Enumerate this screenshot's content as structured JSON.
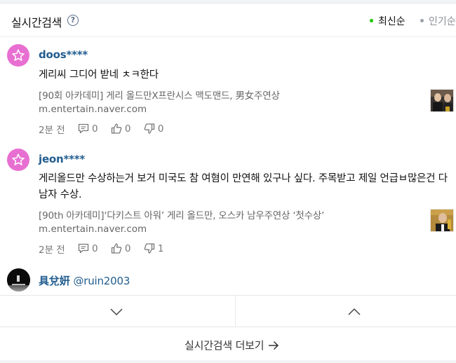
{
  "header": {
    "title": "실시간검색",
    "help_icon": "?",
    "sort_latest": "최신순",
    "sort_popular": "인기순"
  },
  "comments": [
    {
      "avatar": "star-icon",
      "username": "doos****",
      "text": "게리씨 그디어 받네 ㅊㅋ한다",
      "news_title": "[90회 아카데미] 게리 올드만X프란시스 맥도맨드, 男女주연상",
      "news_url": "m.entertain.naver.com",
      "time": "2분 전",
      "reply_count": "0",
      "like_count": "0",
      "dislike_count": "0"
    },
    {
      "avatar": "star-icon",
      "username": "jeon****",
      "text": "게리올드만 수상하는거 보거 미국도 참 여혐이 만연해 있구나 싶다. 주목받고 제일 언급ㅂ많은건 다 남자 수상.",
      "news_title": "[90th 아카데미]‘다키스트 아워’ 게리 올드만, 오스카 남우주연상 ‘첫수상’",
      "news_url": "m.entertain.naver.com",
      "time": "2분 전",
      "reply_count": "0",
      "like_count": "0",
      "dislike_count": "1"
    },
    {
      "avatar": "profile-photo",
      "username": "具兌姸",
      "handle": "@ruin2003"
    }
  ],
  "more_label": "실시간검색 더보기",
  "colors": {
    "username": "#215d8f",
    "avatar": "#e86fd2",
    "latest_dot": "#1ec800"
  }
}
